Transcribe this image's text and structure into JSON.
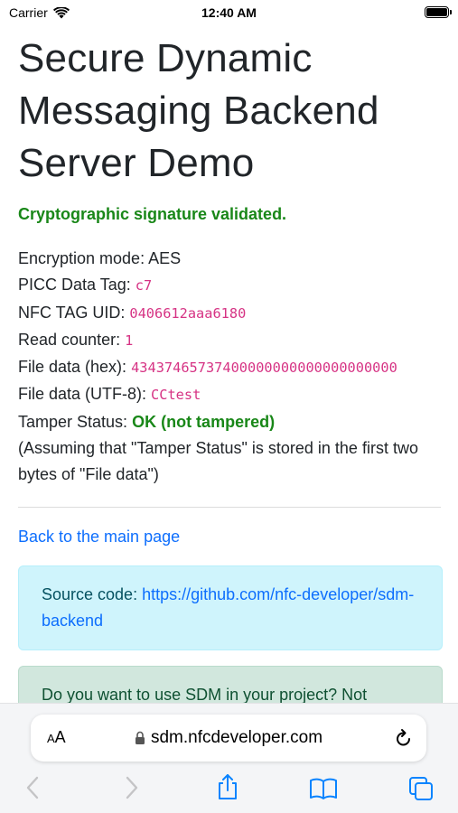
{
  "status_bar": {
    "carrier": "Carrier",
    "time": "12:40 AM"
  },
  "page": {
    "title": "Secure Dynamic Messaging Backend Server Demo",
    "validated": "Cryptographic signature validated.",
    "fields": [
      {
        "label": "Encryption mode:",
        "value": "AES",
        "style": "plain"
      },
      {
        "label": "PICC Data Tag:",
        "value": "c7",
        "style": "code"
      },
      {
        "label": "NFC TAG UID:",
        "value": "0406612aaa6180",
        "style": "code"
      },
      {
        "label": "Read counter:",
        "value": "1",
        "style": "code"
      },
      {
        "label": "File data (hex):",
        "value": "43437465737400000000000000000000",
        "style": "code"
      },
      {
        "label": "File data (UTF-8):",
        "value": "CCtest",
        "style": "code"
      },
      {
        "label": "Tamper Status:",
        "value": "OK (not tampered)",
        "style": "ok"
      }
    ],
    "note": "(Assuming that \"Tamper Status\" is stored in the first two bytes of \"File data\")",
    "back_link": "Back to the main page",
    "source_label": "Source code:",
    "source_url": "https://github.com/nfc-developer/sdm-backend",
    "promo": "Do you want to use SDM in your project? Not"
  },
  "browser": {
    "text_size_label_small": "A",
    "text_size_label_large": "A",
    "url": "sdm.nfcdeveloper.com"
  },
  "colors": {
    "success_green": "#198718",
    "code_pink": "#d63384",
    "link_blue": "#0d6efd",
    "info_bg": "#cff4fc",
    "success_bg": "#d1e7dd"
  }
}
